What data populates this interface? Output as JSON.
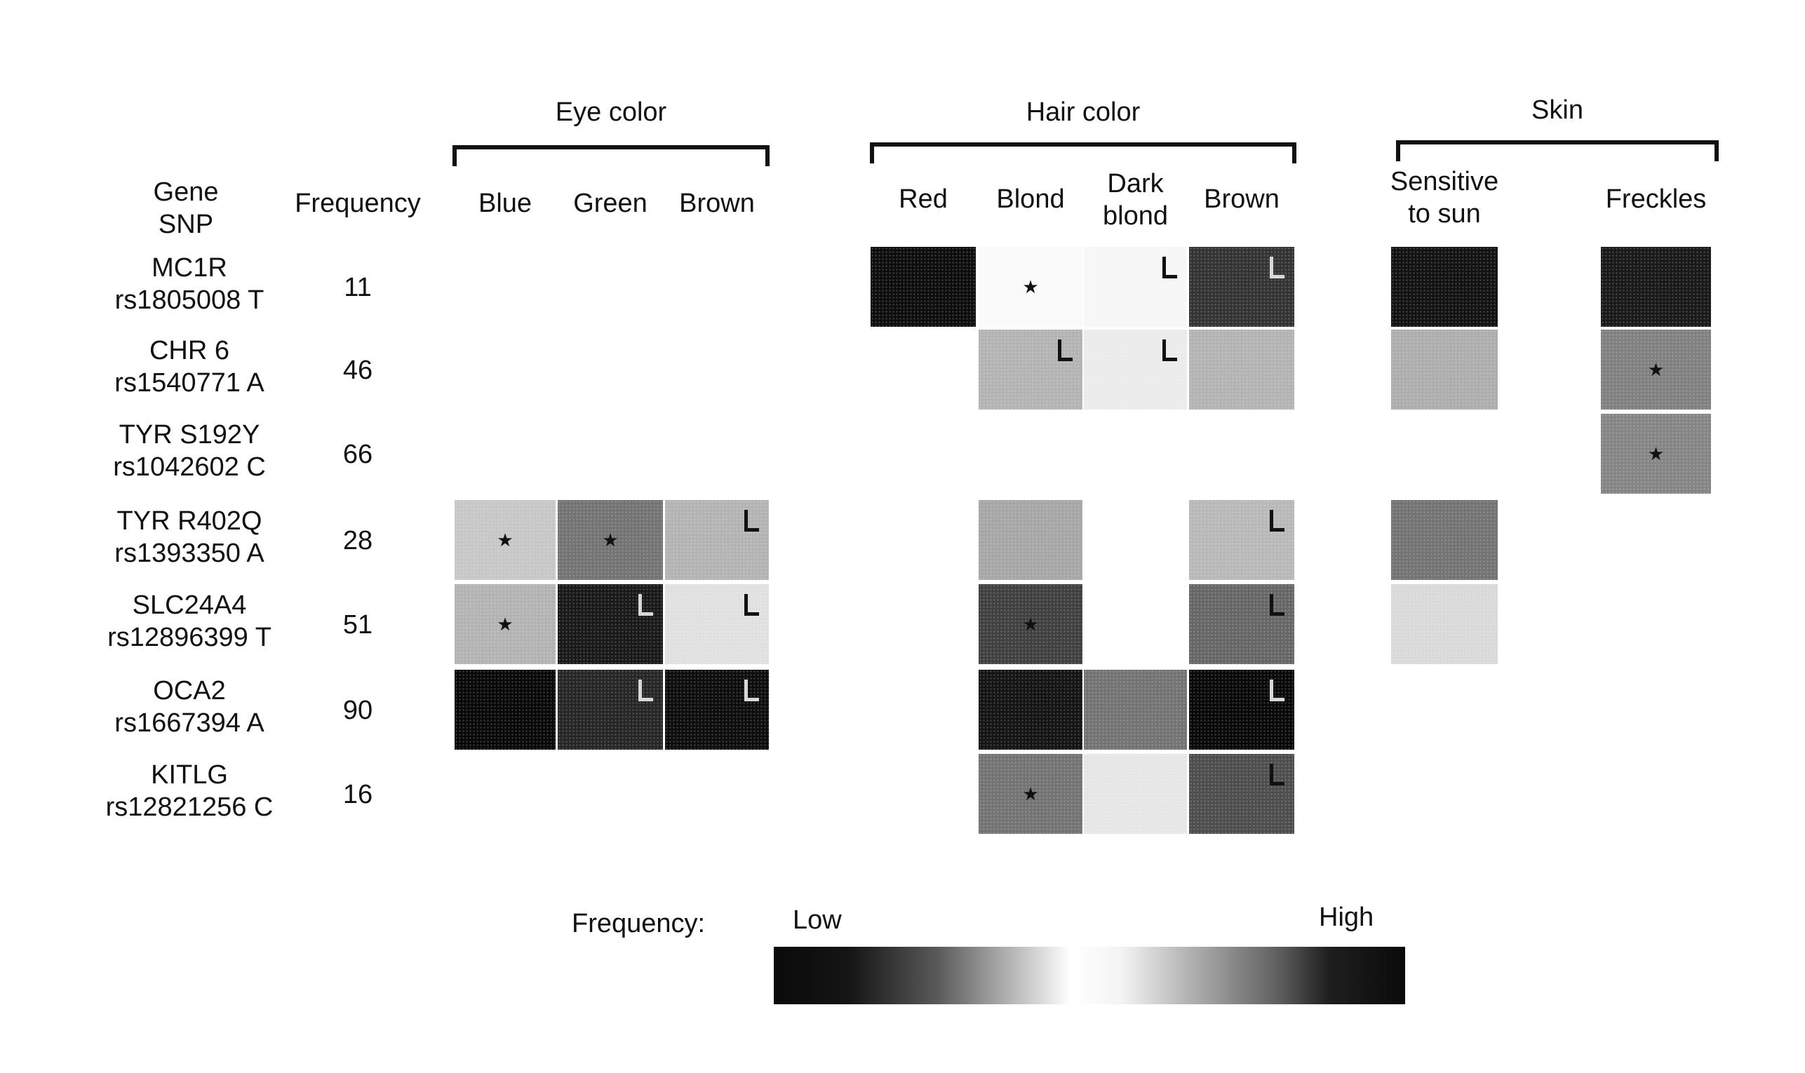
{
  "chart_data": {
    "type": "heatmap",
    "title": "",
    "row_header": [
      "Gene",
      "SNP"
    ],
    "freq_header": "Frequency",
    "groups": [
      {
        "name": "Eye color",
        "columns": [
          "Blue",
          "Green",
          "Brown"
        ]
      },
      {
        "name": "Hair color",
        "columns": [
          "Red",
          "Blond",
          "Dark blond",
          "Brown"
        ]
      },
      {
        "name": "Skin",
        "columns": [
          "Sensitive to sun",
          "Freckles"
        ]
      }
    ],
    "columns": [
      {
        "key": "eye_blue",
        "group": "Eye color",
        "label_lines": [
          "Blue"
        ]
      },
      {
        "key": "eye_green",
        "group": "Eye color",
        "label_lines": [
          "Green"
        ]
      },
      {
        "key": "eye_brown",
        "group": "Eye color",
        "label_lines": [
          "Brown"
        ]
      },
      {
        "key": "hair_red",
        "group": "Hair color",
        "label_lines": [
          "Red"
        ]
      },
      {
        "key": "hair_blond",
        "group": "Hair color",
        "label_lines": [
          "Blond"
        ]
      },
      {
        "key": "hair_darkblond",
        "group": "Hair color",
        "label_lines": [
          "Dark",
          "blond"
        ]
      },
      {
        "key": "hair_brown",
        "group": "Hair color",
        "label_lines": [
          "Brown"
        ]
      },
      {
        "key": "skin_sensitive",
        "group": "Skin",
        "label_lines": [
          "Sensitive",
          "to sun"
        ]
      },
      {
        "key": "skin_freckles",
        "group": "Skin",
        "label_lines": [
          "Freckles"
        ]
      }
    ],
    "rows": [
      {
        "gene": "MC1R",
        "snp": "rs1805008 T",
        "frequency": 11
      },
      {
        "gene": "CHR 6",
        "snp": "rs1540771 A",
        "frequency": 46
      },
      {
        "gene": "TYR S192Y",
        "snp": "rs1042602 C",
        "frequency": 66
      },
      {
        "gene": "TYR R402Q",
        "snp": "rs1393350 A",
        "frequency": 28
      },
      {
        "gene": "SLC24A4",
        "snp": "rs12896399 T",
        "frequency": 51
      },
      {
        "gene": "OCA2",
        "snp": "rs1667394  A",
        "frequency": 90
      },
      {
        "gene": "KITLG",
        "snp": "rs12821256 C",
        "frequency": 16
      }
    ],
    "cells_note": "intensity = visual darkness 0 (white, mid-scale) to 1 (black, scale extreme); marker: 'star', 'L', or ''",
    "cells": [
      {
        "row": 0,
        "col": "hair_red",
        "intensity": 0.95,
        "marker": ""
      },
      {
        "row": 0,
        "col": "hair_blond",
        "intensity": 0.02,
        "marker": "star"
      },
      {
        "row": 0,
        "col": "hair_darkblond",
        "intensity": 0.03,
        "marker": "L"
      },
      {
        "row": 0,
        "col": "hair_brown",
        "intensity": 0.8,
        "marker": "L"
      },
      {
        "row": 0,
        "col": "skin_sensitive",
        "intensity": 0.93,
        "marker": ""
      },
      {
        "row": 0,
        "col": "skin_freckles",
        "intensity": 0.9,
        "marker": ""
      },
      {
        "row": 1,
        "col": "hair_blond",
        "intensity": 0.3,
        "marker": "L"
      },
      {
        "row": 1,
        "col": "hair_darkblond",
        "intensity": 0.08,
        "marker": "L"
      },
      {
        "row": 1,
        "col": "hair_brown",
        "intensity": 0.3,
        "marker": ""
      },
      {
        "row": 1,
        "col": "skin_sensitive",
        "intensity": 0.32,
        "marker": ""
      },
      {
        "row": 1,
        "col": "skin_freckles",
        "intensity": 0.5,
        "marker": "star"
      },
      {
        "row": 2,
        "col": "skin_freckles",
        "intensity": 0.48,
        "marker": "star"
      },
      {
        "row": 3,
        "col": "eye_blue",
        "intensity": 0.22,
        "marker": "star"
      },
      {
        "row": 3,
        "col": "eye_green",
        "intensity": 0.55,
        "marker": "star"
      },
      {
        "row": 3,
        "col": "eye_brown",
        "intensity": 0.3,
        "marker": "L"
      },
      {
        "row": 3,
        "col": "hair_blond",
        "intensity": 0.35,
        "marker": ""
      },
      {
        "row": 3,
        "col": "hair_brown",
        "intensity": 0.28,
        "marker": "L"
      },
      {
        "row": 3,
        "col": "skin_sensitive",
        "intensity": 0.55,
        "marker": ""
      },
      {
        "row": 4,
        "col": "eye_blue",
        "intensity": 0.3,
        "marker": "star"
      },
      {
        "row": 4,
        "col": "eye_green",
        "intensity": 0.9,
        "marker": "L"
      },
      {
        "row": 4,
        "col": "eye_brown",
        "intensity": 0.12,
        "marker": "L"
      },
      {
        "row": 4,
        "col": "hair_blond",
        "intensity": 0.75,
        "marker": "star"
      },
      {
        "row": 4,
        "col": "hair_brown",
        "intensity": 0.6,
        "marker": "L"
      },
      {
        "row": 4,
        "col": "skin_sensitive",
        "intensity": 0.15,
        "marker": ""
      },
      {
        "row": 5,
        "col": "eye_blue",
        "intensity": 0.97,
        "marker": ""
      },
      {
        "row": 5,
        "col": "eye_green",
        "intensity": 0.85,
        "marker": "L"
      },
      {
        "row": 5,
        "col": "eye_brown",
        "intensity": 0.95,
        "marker": "L"
      },
      {
        "row": 5,
        "col": "hair_blond",
        "intensity": 0.92,
        "marker": ""
      },
      {
        "row": 5,
        "col": "hair_darkblond",
        "intensity": 0.55,
        "marker": ""
      },
      {
        "row": 5,
        "col": "hair_brown",
        "intensity": 0.97,
        "marker": "L"
      },
      {
        "row": 6,
        "col": "hair_blond",
        "intensity": 0.55,
        "marker": "star"
      },
      {
        "row": 6,
        "col": "hair_darkblond",
        "intensity": 0.1,
        "marker": ""
      },
      {
        "row": 6,
        "col": "hair_brown",
        "intensity": 0.7,
        "marker": "L"
      }
    ],
    "legend": {
      "label": "Frequency:",
      "low": "Low",
      "high": "High",
      "scale": "dark → white → dark (diverging grayscale)"
    }
  },
  "colors": {
    "ink": "#111111",
    "background": "#ffffff"
  }
}
